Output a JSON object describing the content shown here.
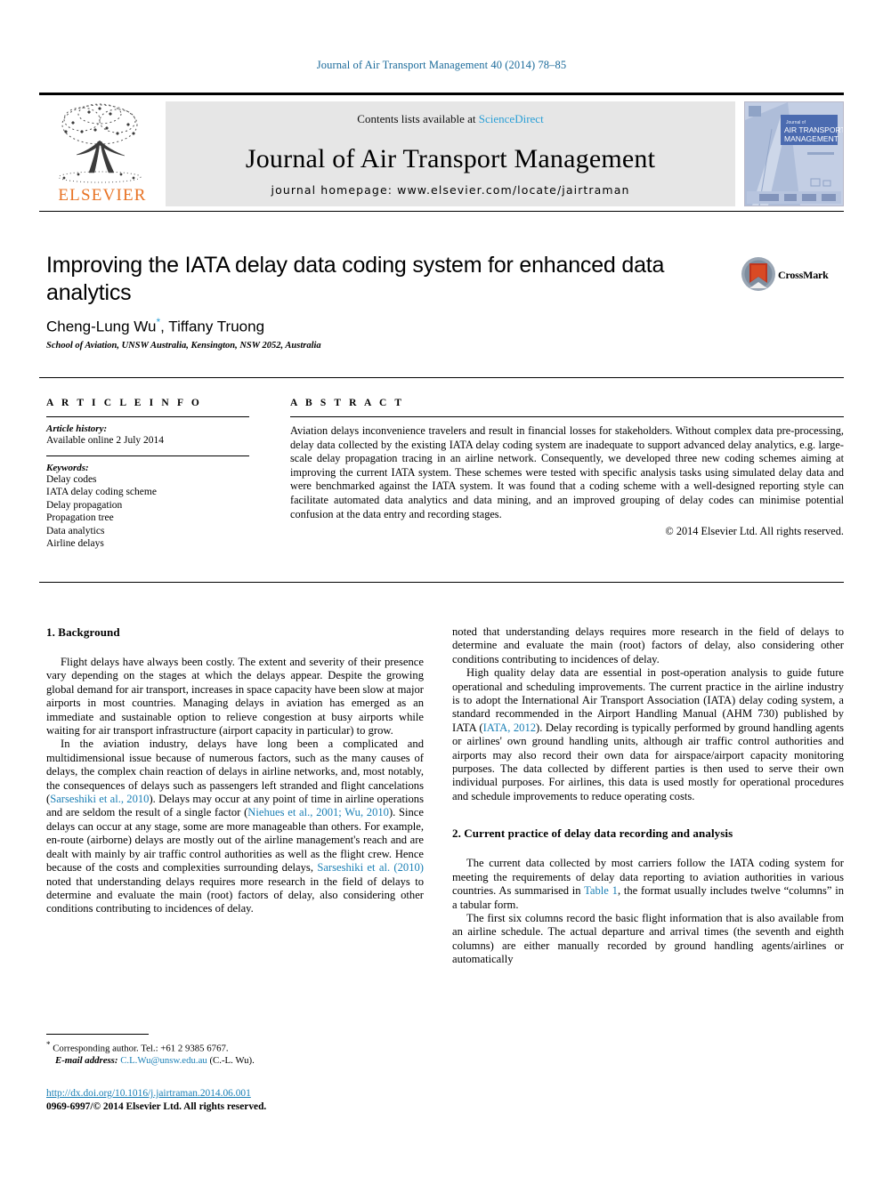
{
  "running_head": "Journal of Air Transport Management 40 (2014) 78–85",
  "masthead": {
    "contents_prefix": "Contents lists available at ",
    "sciencedirect": "ScienceDirect",
    "journal_name": "Journal of Air Transport Management",
    "homepage": "journal homepage: www.elsevier.com/locate/jairtraman",
    "publisher": "ELSEVIER",
    "cover": {
      "top_label": "Journal of",
      "title_line1": "AIR TRANSPORT",
      "title_line2": "MANAGEMENT"
    },
    "colors": {
      "link": "#2a9fd6",
      "band": "#e6e6e6",
      "elsevier_orange": "#e87324",
      "cover_blue": "#9fb2d8"
    }
  },
  "article": {
    "title": "Improving the IATA delay data coding system for enhanced data analytics",
    "authors": "Cheng-Lung Wu",
    "authors_rest": ", Tiffany Truong",
    "corresponding_marker": "*",
    "affiliation": "School of Aviation, UNSW Australia, Kensington, NSW 2052, Australia",
    "crossmark_label": "CrossMark"
  },
  "article_info": {
    "section_label": "A R T I C L E   I N F O",
    "history_head": "Article history:",
    "history_value": "Available online 2 July 2014",
    "keywords_head": "Keywords:",
    "keywords": [
      "Delay codes",
      "IATA delay coding scheme",
      "Delay propagation",
      "Propagation tree",
      "Data analytics",
      "Airline delays"
    ]
  },
  "abstract": {
    "section_label": "A B S T R A C T",
    "text": "Aviation delays inconvenience travelers and result in financial losses for stakeholders. Without complex data pre-processing, delay data collected by the existing IATA delay coding system are inadequate to support advanced delay analytics, e.g. large-scale delay propagation tracing in an airline network. Consequently, we developed three new coding schemes aiming at improving the current IATA system. These schemes were tested with specific analysis tasks using simulated delay data and were benchmarked against the IATA system. It was found that a coding scheme with a well-designed reporting style can facilitate automated data analytics and data mining, and an improved grouping of delay codes can minimise potential confusion at the data entry and recording stages.",
    "rights": "© 2014 Elsevier Ltd. All rights reserved."
  },
  "body": {
    "section1_heading": "1. Background",
    "p1": "Flight delays have always been costly. The extent and severity of their presence vary depending on the stages at which the delays appear. Despite the growing global demand for air transport, increases in space capacity have been slow at major airports in most countries. Managing delays in aviation has emerged as an immediate and sustainable option to relieve congestion at busy airports while waiting for air transport infrastructure (airport capacity in particular) to grow.",
    "p2_a": "In the aviation industry, delays have long been a complicated and multidimensional issue because of numerous factors, such as the many causes of delays, the complex chain reaction of delays in airline networks, and, most notably, the consequences of delays such as passengers left stranded and flight cancelations (",
    "p2_cite1": "Sarseshiki et al., 2010",
    "p2_b": "). Delays may occur at any point of time in airline operations and are seldom the result of a single factor (",
    "p2_cite2": "Niehues et al., 2001; Wu, 2010",
    "p2_c": "). Since delays can occur at any stage, some are more manageable than others. For example, en-route (airborne) delays are mostly out of the airline management's reach and are dealt with mainly by air traffic control authorities as well as the flight crew. Hence because of the costs and complexities surrounding delays, ",
    "p2_cite3": "Sarseshiki et al. (2010)",
    "p2_d": " noted that understanding delays requires more research in the field of delays to determine and evaluate the main (root) factors of delay, also considering other conditions contributing to incidences of delay.",
    "p3_a": "High quality delay data are essential in post-operation analysis to guide future operational and scheduling improvements. The current practice in the airline industry is to adopt the International Air Transport Association (IATA) delay coding system, a standard recommended in the Airport Handling Manual (AHM 730) published by IATA (",
    "p3_cite": "IATA, 2012",
    "p3_b": "). Delay recording is typically performed by ground handling agents or airlines' own ground handling units, although air traffic control authorities and airports may also record their own data for airspace/airport capacity monitoring purposes. The data collected by different parties is then used to serve their own individual purposes. For airlines, this data is used mostly for operational procedures and schedule improvements to reduce operating costs.",
    "section2_heading": "2. Current practice of delay data recording and analysis",
    "p4_a": "The current data collected by most carriers follow the IATA coding system for meeting the requirements of delay data reporting to aviation authorities in various countries. As summarised in ",
    "p4_cite": "Table 1",
    "p4_b": ", the format usually includes twelve “columns” in a tabular form.",
    "p5": "The first six columns record the basic flight information that is also available from an airline schedule. The actual departure and arrival times (the seventh and eighth columns) are either manually recorded by ground handling agents/airlines or automatically"
  },
  "footer": {
    "corr_marker": "*",
    "corr_text": " Corresponding author. Tel.: +61 2 9385 6767.",
    "email_label": "E-mail address:",
    "email": "C.L.Wu@unsw.edu.au",
    "email_suffix": " (C.-L. Wu).",
    "doi": "http://dx.doi.org/10.1016/j.jairtraman.2014.06.001",
    "issn": "0969-6997/© 2014 Elsevier Ltd. All rights reserved."
  }
}
